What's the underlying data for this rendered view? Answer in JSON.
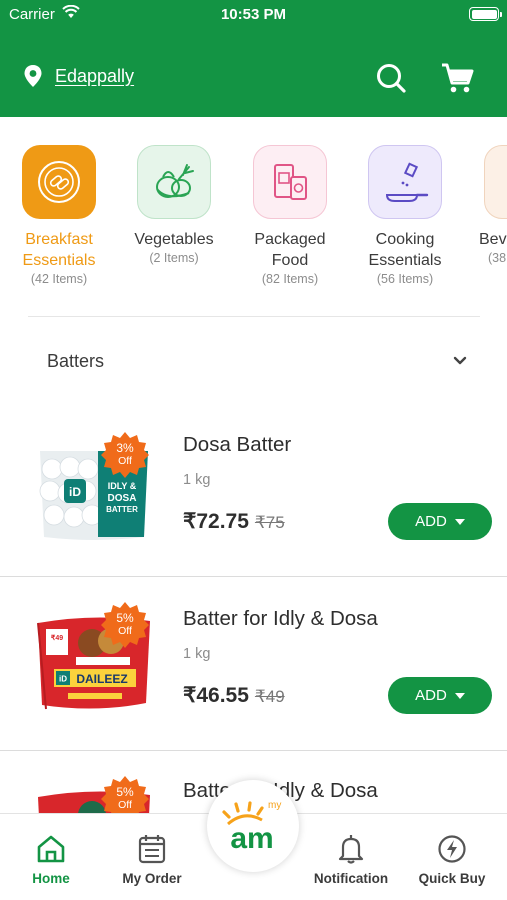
{
  "status_bar": {
    "carrier": "Carrier",
    "time": "10:53 PM"
  },
  "header": {
    "location": "Edappally"
  },
  "categories": [
    {
      "name": "Breakfast Essentials",
      "line1": "Breakfast",
      "line2": "Essentials",
      "count": "(42 Items)",
      "color": "#ef9a15",
      "active": true
    },
    {
      "name": "Vegetables",
      "line1": "Vegetables",
      "line2": "",
      "count": "(2 Items)",
      "color": "#e6f5ea"
    },
    {
      "name": "Packaged Food",
      "line1": "Packaged",
      "line2": "Food",
      "count": "(82 Items)",
      "color": "#fdeef3"
    },
    {
      "name": "Cooking Essentials",
      "line1": "Cooking",
      "line2": "Essentials",
      "count": "(56 Items)",
      "color": "#eeeafc"
    },
    {
      "name": "Beverages",
      "line1": "Bev",
      "line2": "",
      "count": "(38",
      "color": "#fcf0e6"
    }
  ],
  "filter": {
    "label": "Batters"
  },
  "products": [
    {
      "name": "Dosa Batter",
      "weight": "1 kg",
      "price": "₹72.75",
      "mrp": "₹75",
      "discount_pct": "3%",
      "discount_label": "Off",
      "add_label": "ADD"
    },
    {
      "name": "Batter for Idly & Dosa",
      "weight": "1 kg",
      "price": "₹46.55",
      "mrp": "₹49",
      "discount_pct": "5%",
      "discount_label": "Off",
      "add_label": "ADD"
    },
    {
      "name": "Batter for Idly & Dosa",
      "discount_pct": "5%",
      "discount_label": "Off"
    }
  ],
  "product_images": {
    "idly_pack_text": "IDLY & DOSA BATTER",
    "daileez_brand": "DAILEEZ",
    "price_tag": "₹49"
  },
  "bottom_nav": {
    "home": "Home",
    "my_order": "My Order",
    "notification": "Notification",
    "quick_buy": "Quick Buy",
    "logo_small": "my",
    "logo_main": "am"
  },
  "colors": {
    "brand_green": "#139444",
    "accent_orange": "#ef9a15",
    "badge_orange": "#f06b1a"
  }
}
